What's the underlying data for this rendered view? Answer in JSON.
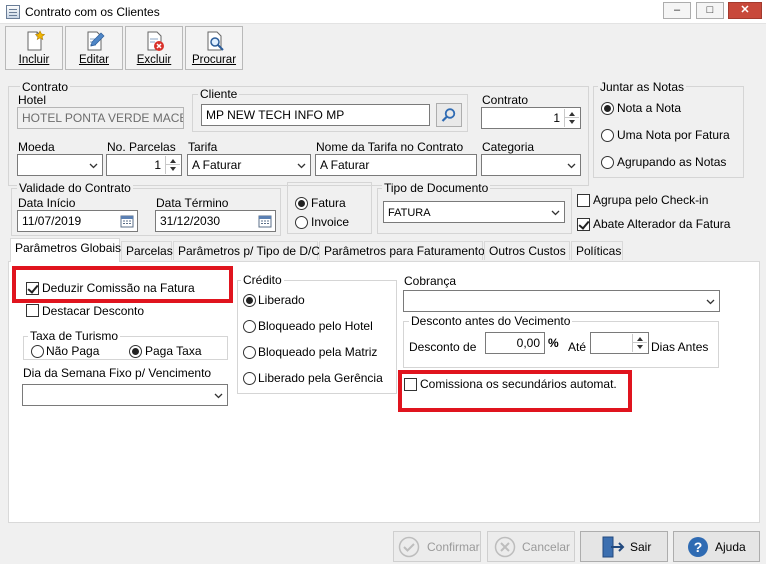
{
  "window": {
    "title": "Contrato com os Clientes",
    "buttons": {
      "minimize": "–",
      "maximize": "□",
      "close": "✕"
    }
  },
  "toolbar": {
    "incluir": "Incluir",
    "editar": "Editar",
    "excluir": "Excluir",
    "procurar": "Procurar"
  },
  "contrato": {
    "legend": "Contrato",
    "hotel_label": "Hotel",
    "hotel_value": "HOTEL PONTA VERDE MACEIÓ",
    "cliente_legend": "Cliente",
    "cliente_value": "MP NEW TECH INFO MP",
    "contrato_label": "Contrato",
    "contrato_value": "1",
    "moeda_label": "Moeda",
    "moeda_value": "",
    "parcelas_label": "No. Parcelas",
    "parcelas_value": "1",
    "tarifa_label": "Tarifa",
    "tarifa_value": "A Faturar",
    "nome_tarifa_label": "Nome da Tarifa no Contrato",
    "nome_tarifa_value": "A Faturar",
    "categoria_label": "Categoria",
    "categoria_value": ""
  },
  "juntar": {
    "legend": "Juntar as Notas",
    "options": [
      "Nota a Nota",
      "Uma Nota por Fatura",
      "Agrupando as Notas"
    ],
    "selected": 0
  },
  "validade": {
    "legend": "Validade do Contrato",
    "inicio_label": "Data Início",
    "inicio_value": "11/07/2019",
    "termino_label": "Data Término",
    "termino_value": "31/12/2030"
  },
  "fatura_invoice": {
    "options": [
      "Fatura",
      "Invoice"
    ],
    "selected": 0
  },
  "tipo_documento": {
    "legend": "Tipo de Documento",
    "value": "FATURA"
  },
  "checks_right": {
    "agrupa_checkin": {
      "label": "Agrupa pelo Check-in",
      "checked": false
    },
    "abate_alterador": {
      "label": "Abate Alterador da Fatura",
      "checked": true
    }
  },
  "tabs": [
    "Parâmetros Globais",
    "Parcelas",
    "Parâmetros p/ Tipo de D/C",
    "Parâmetros para Faturamento",
    "Outros Custos",
    "Políticas"
  ],
  "active_tab": 0,
  "globais": {
    "deduzir_comissao": {
      "label": "Deduzir Comissão na Fatura",
      "checked": true
    },
    "destacar_desconto": {
      "label": "Destacar Desconto",
      "checked": false
    },
    "taxa_turismo": {
      "legend": "Taxa de Turismo",
      "options": [
        "Não Paga",
        "Paga Taxa"
      ],
      "selected": 1
    },
    "dia_semana_label": "Dia da Semana Fixo p/ Vencimento",
    "dia_semana_value": "",
    "credito": {
      "legend": "Crédito",
      "options": [
        "Liberado",
        "Bloqueado pelo Hotel",
        "Bloqueado pela Matriz",
        "Liberado pela Gerência"
      ],
      "selected": 0
    },
    "cobranca_label": "Cobrança",
    "cobranca_value": "",
    "desconto": {
      "legend": "Desconto antes do Vecimento",
      "desconto_label": "Desconto de",
      "desconto_value": "0,00",
      "percent": "%",
      "ate_label": "Até",
      "ate_value": "",
      "dias_label": "Dias Antes"
    },
    "comissiona_secundarios": {
      "label": "Comissiona os secundários automat.",
      "checked": false
    }
  },
  "footer": {
    "confirmar": "Confirmar",
    "cancelar": "Cancelar",
    "sair": "Sair",
    "ajuda": "Ajuda"
  },
  "colors": {
    "highlight": "#e0141e",
    "close_button": "#c8493b"
  }
}
